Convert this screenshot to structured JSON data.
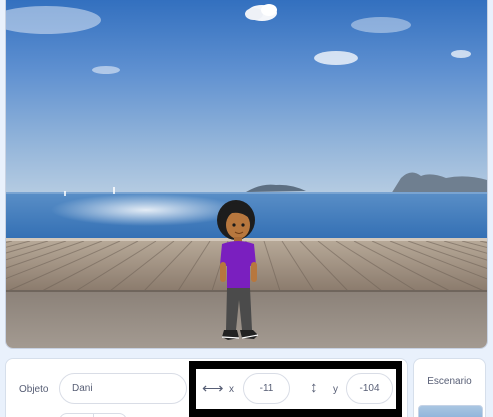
{
  "stage": {
    "scene": "beach boardwalk backdrop with a boy sprite",
    "colors": {
      "sky_top": "#2f6fc0",
      "sky_bottom": "#a6c3df",
      "sea": "#3f7fc0",
      "boardwalk": "#9a8c80",
      "shirt": "#7a1fbf",
      "pants": "#4b4b4b"
    }
  },
  "sprite_info": {
    "name_label": "Objeto",
    "name_value": "Dani",
    "x_label": "x",
    "x_value": "-11",
    "y_label": "y",
    "y_value": "-104",
    "x_icon": "horizontal-arrows-icon",
    "y_icon": "vertical-arrows-icon"
  },
  "stage_selector": {
    "title": "Escenario"
  }
}
